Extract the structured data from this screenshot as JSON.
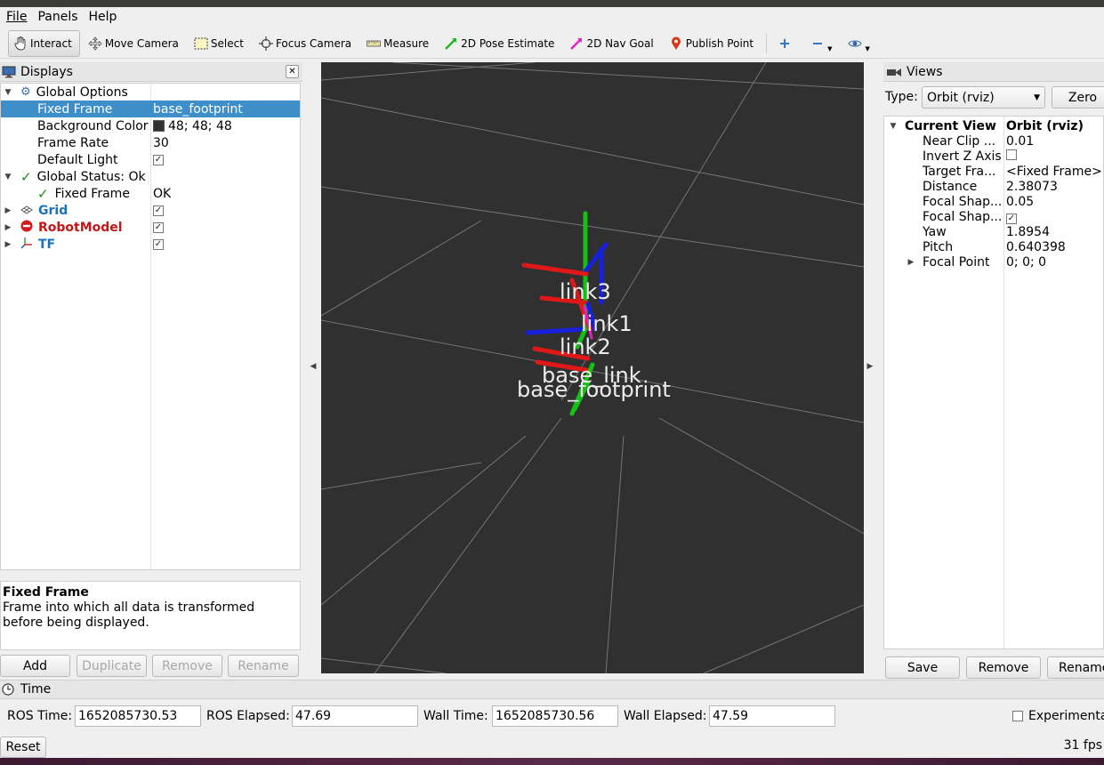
{
  "menu": {
    "file": "File",
    "panels": "Panels",
    "help": "Help"
  },
  "toolbar": {
    "interact": "Interact",
    "move_camera": "Move Camera",
    "select": "Select",
    "focus_camera": "Focus Camera",
    "measure": "Measure",
    "pose_estimate": "2D Pose Estimate",
    "nav_goal": "2D Nav Goal",
    "publish_point": "Publish Point"
  },
  "displays": {
    "title": "Displays",
    "global_options": "Global Options",
    "fixed_frame_label": "Fixed Frame",
    "fixed_frame_value": "base_footprint",
    "background_color_label": "Background Color",
    "background_color_value": "48; 48; 48",
    "frame_rate_label": "Frame Rate",
    "frame_rate_value": "30",
    "default_light_label": "Default Light",
    "global_status": "Global Status: Ok",
    "status_fixed_frame": "Fixed Frame",
    "status_ok": "OK",
    "grid": "Grid",
    "robot_model": "RobotModel",
    "tf": "TF",
    "desc_title": "Fixed Frame",
    "desc_text": "Frame into which all data is transformed before being displayed.",
    "add": "Add",
    "duplicate": "Duplicate",
    "remove": "Remove",
    "rename": "Rename"
  },
  "viewport": {
    "labels": [
      "link3",
      "link1",
      "link2",
      "base_link",
      "base_footprint"
    ],
    "background": "#303030"
  },
  "views": {
    "title": "Views",
    "type_label": "Type:",
    "type_value": "Orbit (rviz)",
    "zero": "Zero",
    "current_view": "Current View",
    "current_view_value": "Orbit (rviz)",
    "props": [
      {
        "k": "Near Clip ...",
        "v": "0.01"
      },
      {
        "k": "Invert Z Axis",
        "v": ""
      },
      {
        "k": "Target Fra...",
        "v": "<Fixed Frame>"
      },
      {
        "k": "Distance",
        "v": "2.38073"
      },
      {
        "k": "Focal Shap...",
        "v": "0.05"
      },
      {
        "k": "Focal Shap...",
        "v": ""
      },
      {
        "k": "Yaw",
        "v": "1.8954"
      },
      {
        "k": "Pitch",
        "v": "0.640398"
      },
      {
        "k": "Focal Point",
        "v": "0; 0; 0"
      }
    ],
    "save": "Save",
    "remove": "Remove",
    "rename": "Rename"
  },
  "time": {
    "title": "Time",
    "ros_time_label": "ROS Time:",
    "ros_time": "1652085730.53",
    "ros_elapsed_label": "ROS Elapsed:",
    "ros_elapsed": "47.69",
    "wall_time_label": "Wall Time:",
    "wall_time": "1652085730.56",
    "wall_elapsed_label": "Wall Elapsed:",
    "wall_elapsed": "47.59",
    "experimental": "Experimental",
    "reset": "Reset",
    "fps": "31 fps"
  }
}
